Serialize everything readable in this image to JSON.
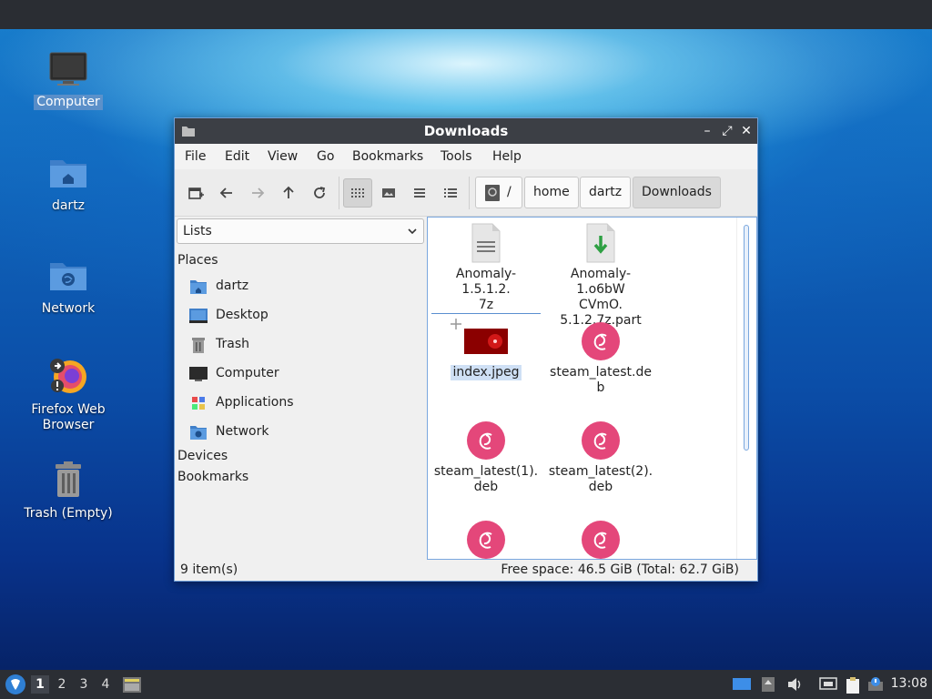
{
  "desktop": {
    "icons": [
      {
        "label": "Computer"
      },
      {
        "label": "dartz"
      },
      {
        "label": "Network"
      },
      {
        "label": "Firefox Web Browser"
      },
      {
        "label": "Trash (Empty)"
      }
    ]
  },
  "window": {
    "title": "Downloads",
    "controls": {
      "minimize": "–",
      "maximize": "⤢",
      "close": "✕"
    }
  },
  "menu": {
    "file": "File",
    "edit": "Edit",
    "view": "View",
    "go": "Go",
    "bookmarks": "Bookmarks",
    "tools": "Tools",
    "help": "Help"
  },
  "breadcrumb": {
    "root": "/",
    "home": "home",
    "user": "dartz",
    "current": "Downloads"
  },
  "sidebar": {
    "select_value": "Lists",
    "places_header": "Places",
    "places": [
      {
        "label": "dartz",
        "icon": "home-folder-icon"
      },
      {
        "label": "Desktop",
        "icon": "desktop-icon"
      },
      {
        "label": "Trash",
        "icon": "trash-icon"
      },
      {
        "label": "Computer",
        "icon": "computer-icon"
      },
      {
        "label": "Applications",
        "icon": "applications-icon"
      },
      {
        "label": "Network",
        "icon": "network-folder-icon"
      }
    ],
    "devices_header": "Devices",
    "bookmarks_header": "Bookmarks"
  },
  "files": [
    {
      "name_line1": "Anomaly-1.5.1.2.",
      "name_line2": "7z",
      "type": "archive"
    },
    {
      "name_line1": "Anomaly-1.o6bW",
      "name_line2": "CVmO.",
      "name_line3": "5.1.2.7z.part",
      "type": "download"
    },
    {
      "name_line1": "index.jpeg",
      "type": "image"
    },
    {
      "name_line1": "steam_latest.de",
      "name_line2": "b",
      "type": "deb"
    },
    {
      "name_line1": "steam_latest(1).",
      "name_line2": "deb",
      "type": "deb"
    },
    {
      "name_line1": "steam_latest(2).",
      "name_line2": "deb",
      "type": "deb"
    },
    {
      "type": "deb"
    },
    {
      "type": "deb"
    }
  ],
  "status": {
    "items": "9 item(s)",
    "space": "Free space: 46.5 GiB (Total: 62.7 GiB)"
  },
  "taskbar": {
    "workspaces": [
      "1",
      "2",
      "3",
      "4"
    ],
    "active_workspace": "1",
    "clock": "13:08"
  },
  "colors": {
    "debian_red": "#e4477a",
    "window_border": "#6f9fd8",
    "titlebar": "#3c3f45"
  }
}
